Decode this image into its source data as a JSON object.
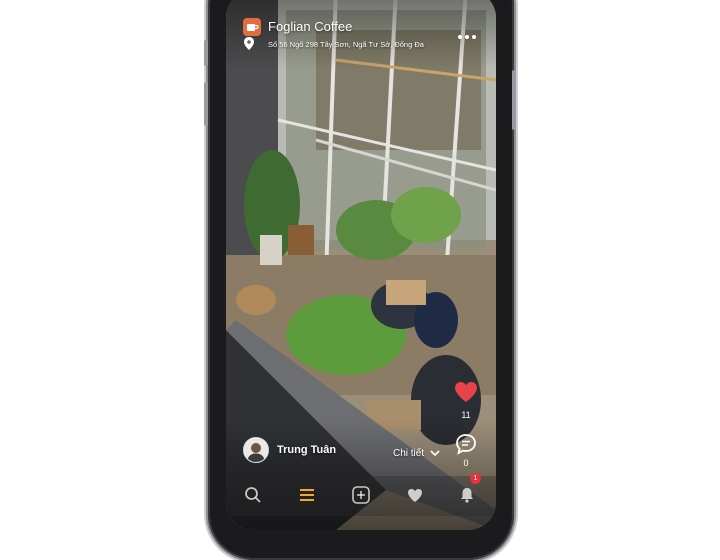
{
  "post": {
    "shop_name": "Foglian Coffee",
    "address": "Số 56 Ngõ 298 Tây Sơn, Ngã Tư Sở, Đống Đa",
    "author": "Trung Tuân",
    "detail_label": "Chi tiết",
    "likes": "11",
    "comments": "0"
  },
  "nav": {
    "items": [
      "search-icon",
      "menu-icon",
      "add-icon",
      "heart-icon",
      "notifications-icon"
    ],
    "badge_count": "1"
  },
  "colors": {
    "brand_orange": "#e26c3f",
    "like_red": "#e8434b",
    "active_tab": "#f5a623",
    "badge_red": "#e8313a"
  }
}
